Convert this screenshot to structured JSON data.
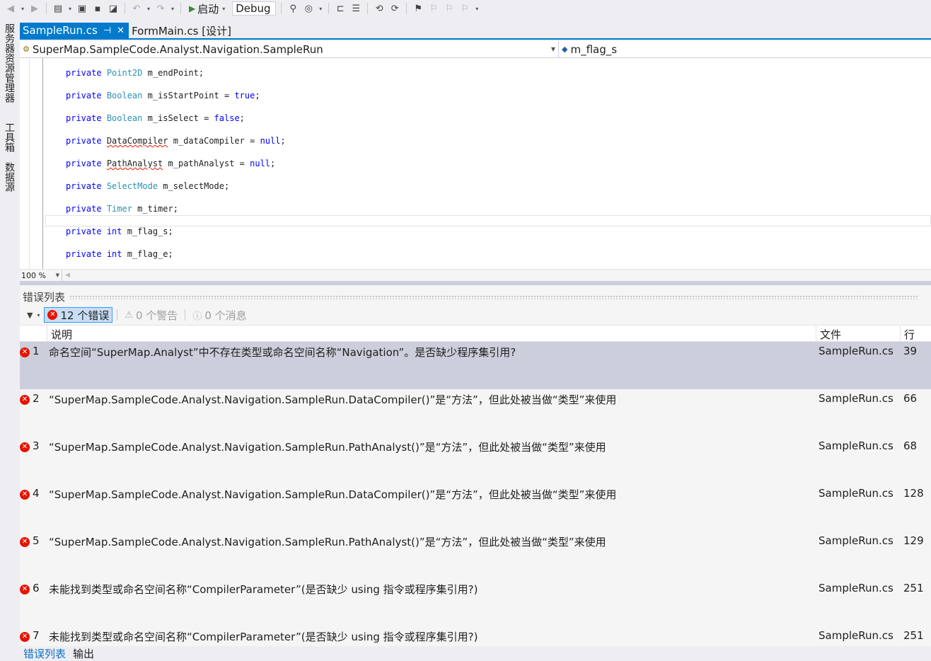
{
  "toolbar": {
    "start_label": "启动",
    "config_value": "Debug",
    "icons": [
      "back-icon",
      "forward-icon",
      "new-project-icon",
      "open-icon",
      "save-icon",
      "save-all-icon",
      "undo-icon",
      "redo-icon",
      "start-icon",
      "find-icon",
      "browse-icon",
      "bookmark-icon"
    ]
  },
  "side_tabs": [
    "服务器资源管理器",
    "工具箱",
    "数据源"
  ],
  "doc_tabs": [
    {
      "label": "SampleRun.cs",
      "active": true
    },
    {
      "label": "FormMain.cs [设计]",
      "active": false
    }
  ],
  "navbar": {
    "type_combo": "SuperMap.SampleCode.Analyst.Navigation.SampleRun",
    "member_combo": "m_flag_s"
  },
  "code": {
    "lines": [
      {
        "kw": "private",
        "type": "Point2D",
        "rest": " m_endPoint;",
        "type_kind": "type"
      },
      {
        "kw": "private",
        "type": "Boolean",
        "rest": " m_isStartPoint = ",
        "val": "true",
        "end": ";",
        "type_kind": "type"
      },
      {
        "kw": "private",
        "type": "Boolean",
        "rest": " m_isSelect = ",
        "val": "false",
        "end": ";",
        "type_kind": "type"
      },
      {
        "kw": "private",
        "type": "DataCompiler",
        "rest": " m_dataCompiler = ",
        "val": "null",
        "end": ";",
        "type_kind": "error"
      },
      {
        "kw": "private",
        "type": "PathAnalyst",
        "rest": " m_pathAnalyst = ",
        "val": "null",
        "end": ";",
        "type_kind": "error"
      },
      {
        "kw": "private",
        "type": "SelectMode",
        "rest": " m_selectMode;",
        "type_kind": "type"
      },
      {
        "kw": "private",
        "type": "Timer",
        "rest": " m_timer;",
        "type_kind": "type"
      },
      {
        "kw": "private",
        "type": "int",
        "rest": " m_flag_s;",
        "type_kind": "kw"
      },
      {
        "kw": "private",
        "type": "int",
        "rest": " m_flag_e;",
        "type_kind": "kw"
      }
    ]
  },
  "zoom": "100 %",
  "error_list": {
    "title": "错误列表",
    "errors_filter": "12 个错误",
    "warnings_filter": "0 个警告",
    "messages_filter": "0 个消息",
    "col_desc": "说明",
    "col_file": "文件",
    "col_line": "行",
    "rows": [
      {
        "num": "1",
        "desc": "命名空间“SuperMap.Analyst”中不存在类型或命名空间名称“Navigation”。是否缺少程序集引用?",
        "file": "SampleRun.cs",
        "line": "39"
      },
      {
        "num": "2",
        "desc": "“SuperMap.SampleCode.Analyst.Navigation.SampleRun.DataCompiler()”是“方法”，但此处被当做“类型”来使用",
        "file": "SampleRun.cs",
        "line": "66"
      },
      {
        "num": "3",
        "desc": "“SuperMap.SampleCode.Analyst.Navigation.SampleRun.PathAnalyst()”是“方法”，但此处被当做“类型”来使用",
        "file": "SampleRun.cs",
        "line": "68"
      },
      {
        "num": "4",
        "desc": "“SuperMap.SampleCode.Analyst.Navigation.SampleRun.DataCompiler()”是“方法”，但此处被当做“类型”来使用",
        "file": "SampleRun.cs",
        "line": "128"
      },
      {
        "num": "5",
        "desc": "“SuperMap.SampleCode.Analyst.Navigation.SampleRun.PathAnalyst()”是“方法”，但此处被当做“类型”来使用",
        "file": "SampleRun.cs",
        "line": "129"
      },
      {
        "num": "6",
        "desc": "未能找到类型或命名空间名称“CompilerParameter”(是否缺少 using 指令或程序集引用?)",
        "file": "SampleRun.cs",
        "line": "251"
      },
      {
        "num": "7",
        "desc": "未能找到类型或命名空间名称“CompilerParameter”(是否缺少 using 指令或程序集引用?)",
        "file": "SampleRun.cs",
        "line": "251"
      }
    ]
  },
  "bottom_tabs": [
    {
      "label": "错误列表",
      "active": true
    },
    {
      "label": "输出",
      "active": false
    }
  ],
  "colors": {
    "accent": "#007acc",
    "error": "#e51400",
    "keyword": "#0000ff",
    "type": "#2b91af",
    "selected_row": "#cccedb"
  }
}
